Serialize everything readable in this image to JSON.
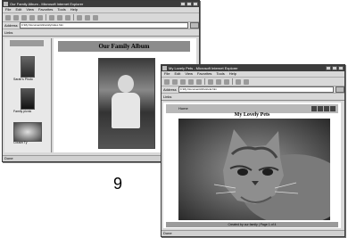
{
  "page_number": "9",
  "back_window": {
    "title": "Our Family Album - Microsoft Internet Explorer",
    "menu": [
      "File",
      "Edit",
      "View",
      "Favorites",
      "Tools",
      "Help"
    ],
    "address_label": "Address",
    "address_value": "C:\\My Documents\\Family\\index.htm",
    "links_label": "Links",
    "page_title": "Our Family Album",
    "thumb_captions": [
      "Sarah's Photo",
      "Family picnic",
      "Cousin Ty"
    ],
    "status_text": "Done"
  },
  "front_window": {
    "title": "My Lovely Pets - Microsoft Internet Explorer",
    "menu": [
      "File",
      "Edit",
      "View",
      "Favorites",
      "Tools",
      "Help"
    ],
    "address_label": "Address",
    "address_value": "C:\\My Documents\\Pets\\cat.htm",
    "links_label": "Links",
    "page_title": "My Lovely Pets",
    "nav_home": "Home",
    "footer_text": "Created by our family | Page 1 of 4",
    "status_text": "Done"
  }
}
